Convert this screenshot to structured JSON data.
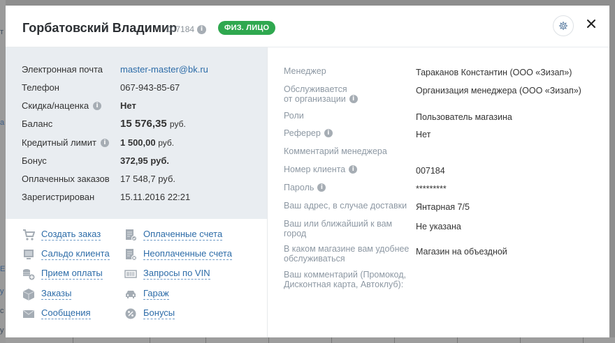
{
  "header": {
    "title": "Горбатовский Владимир",
    "client_id": "007184",
    "badge": "ФИЗ. ЛИЦО",
    "badge_color": "#2fa84f",
    "settings_icon": "gear-icon",
    "close_icon": "close-icon"
  },
  "left_fields": [
    {
      "label": "Электронная почта",
      "value": "master-master@bk.ru"
    },
    {
      "label": "Телефон",
      "value": "067-943-85-67"
    },
    {
      "label": "Скидка/наценка",
      "value": "Нет"
    },
    {
      "label": "Баланс",
      "value": "15 576,35",
      "unit": "руб."
    },
    {
      "label": "Кредитный лимит",
      "value": "1 500,00",
      "unit": "руб."
    },
    {
      "label": "Бонус",
      "value": "372,95 руб."
    },
    {
      "label": "Оплаченных заказов",
      "value": "17 548,7 руб."
    },
    {
      "label": "Зарегистрирован",
      "value": "15.11.2016 22:21"
    }
  ],
  "actions_left": [
    {
      "label": "Создать заказ",
      "icon": "cart-icon"
    },
    {
      "label": "Сальдо клиента",
      "icon": "monitor-icon"
    },
    {
      "label": "Прием оплаты",
      "icon": "coins-add-icon"
    },
    {
      "label": "Заказы",
      "icon": "box-icon"
    },
    {
      "label": "Сообщения",
      "icon": "envelope-icon"
    }
  ],
  "actions_right": [
    {
      "label": "Оплаченные счета",
      "icon": "invoice-paid-icon"
    },
    {
      "label": "Неоплаченные счета",
      "icon": "invoice-unpaid-icon"
    },
    {
      "label": "Запросы по VIN",
      "icon": "barcode-icon"
    },
    {
      "label": "Гараж",
      "icon": "car-icon"
    },
    {
      "label": "Бонусы",
      "icon": "percent-icon"
    }
  ],
  "right_fields": [
    {
      "label": "Менеджер",
      "value": "Тараканов Константин (ООО «Зизап»)"
    },
    {
      "label": "Обслуживается от организации",
      "label_line1": "Обслуживается",
      "label_line2": "от организации",
      "value": "Организация менеджера (ООО «Зизап»)"
    },
    {
      "label": "Роли",
      "value": "Пользователь магазина"
    },
    {
      "label": "Реферер",
      "value": "Нет"
    },
    {
      "label": "Комментарий менеджера",
      "value": ""
    },
    {
      "label": "Номер клиента",
      "value": "007184"
    },
    {
      "label": "Пароль",
      "value": "*********"
    },
    {
      "label": "Ваш адрес, в случае доставки",
      "value": "Янтарная 7/5"
    },
    {
      "label_line1": "Ваш или ближайший к вам",
      "label_line2": "город",
      "value": "Не указана"
    },
    {
      "label_line1": "В каком магазине вам удобнее",
      "label_line2": "обслуживаться",
      "value": "Магазин на объездной"
    },
    {
      "label_line1": "Ваш комментарий (Промокод,",
      "label_line2": "Дисконтная карта, Автоклуб):",
      "value": ""
    }
  ],
  "background": {
    "glyphs": [
      "т",
      "а",
      "Е",
      "у",
      "с",
      "у"
    ]
  }
}
